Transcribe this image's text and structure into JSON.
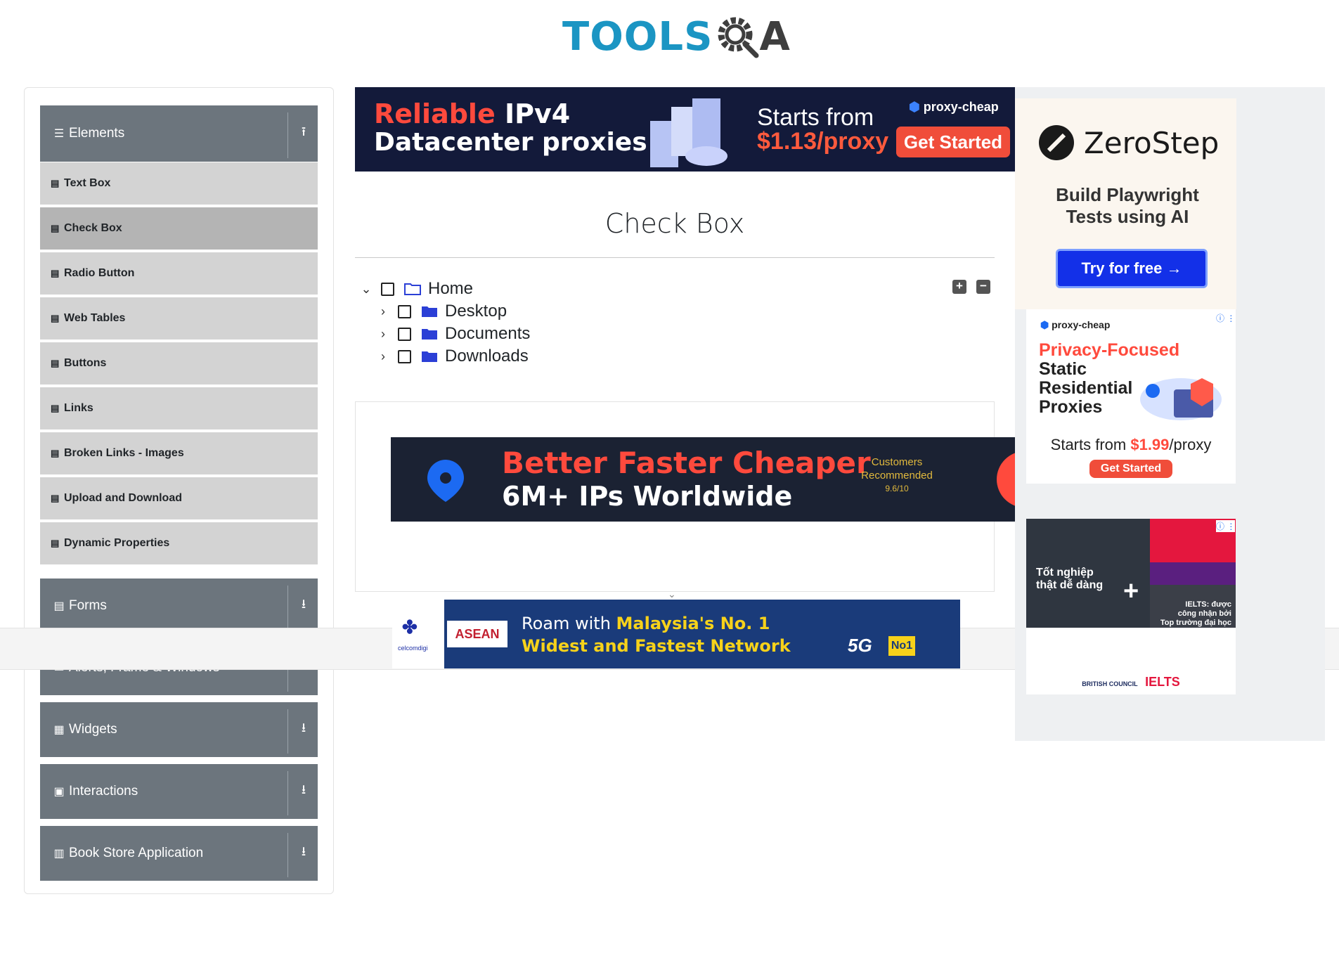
{
  "header": {
    "logo_text_1": "TOOLS",
    "logo_text_2": "QA"
  },
  "sidebar": {
    "groups": [
      {
        "label": "Elements",
        "icon": "hamburger-icon",
        "expanded": true
      },
      {
        "label": "Forms",
        "icon": "form-icon",
        "expanded": false
      },
      {
        "label": "Alerts, Frame & Windows",
        "icon": "window-icon",
        "expanded": false
      },
      {
        "label": "Widgets",
        "icon": "widgets-icon",
        "expanded": false
      },
      {
        "label": "Interactions",
        "icon": "interaction-icon",
        "expanded": false
      },
      {
        "label": "Book Store Application",
        "icon": "book-icon",
        "expanded": false
      }
    ],
    "element_items": [
      "Text Box",
      "Check Box",
      "Radio Button",
      "Web Tables",
      "Buttons",
      "Links",
      "Broken Links - Images",
      "Upload and Download",
      "Dynamic Properties"
    ],
    "active_item": "Check Box"
  },
  "main": {
    "title": "Check Box",
    "tree": [
      {
        "label": "Home",
        "level": 0,
        "expanded": true,
        "checked": false
      },
      {
        "label": "Desktop",
        "level": 1,
        "expanded": false,
        "checked": false
      },
      {
        "label": "Documents",
        "level": 1,
        "expanded": false,
        "checked": false
      },
      {
        "label": "Downloads",
        "level": 1,
        "expanded": false,
        "checked": false
      }
    ],
    "expand_all": "+",
    "collapse_all": "−"
  },
  "ads": {
    "top": {
      "line1a": "Reliable",
      "line1b": " IPv4",
      "line2": "Datacenter proxies",
      "starts": "Starts from",
      "price": "$1.13/proxy",
      "brand": "proxy-cheap",
      "cta": "Get Started"
    },
    "middle": {
      "line1": "Better Faster Cheaper",
      "line2": "6M+ IPs Worldwide",
      "badge1": "Customers",
      "badge2": "Recommended",
      "rating": "9.6/10"
    },
    "bottom": {
      "brand": "celcomdigi",
      "asean": "ASEAN",
      "line1a": "Roam with ",
      "line1b": "Malaysia's No. 1",
      "line2": "Widest and Fastest Network",
      "tag5g": "5G",
      "no1": "No1"
    },
    "zerostep": {
      "brand": "ZeroStep",
      "tagline": "Build Playwright Tests using AI",
      "cta": "Try for free →"
    },
    "proxycheap": {
      "brand": "proxy-cheap",
      "line1": "Privacy-Focused",
      "line2": "Static",
      "line3": "Residential",
      "line4": "Proxies",
      "starts": "Starts from ",
      "price": "$1.99",
      "unit": "/proxy",
      "cta": "Get Started"
    },
    "ielts": {
      "text1": "Tốt nghiệp",
      "text2": "thật dễ dàng",
      "text3": "IELTS: được",
      "text4": "công nhận bởi",
      "text5": "Top trường đại học",
      "brand": "BRITISH COUNCIL",
      "logo": "IELTS"
    }
  },
  "colors": {
    "sidebar_header": "#6c757d",
    "menu_item": "#d3d3d3",
    "menu_active": "#b4b4b4",
    "brand_blue": "#1b95c3",
    "folder": "#2b3fd6"
  }
}
